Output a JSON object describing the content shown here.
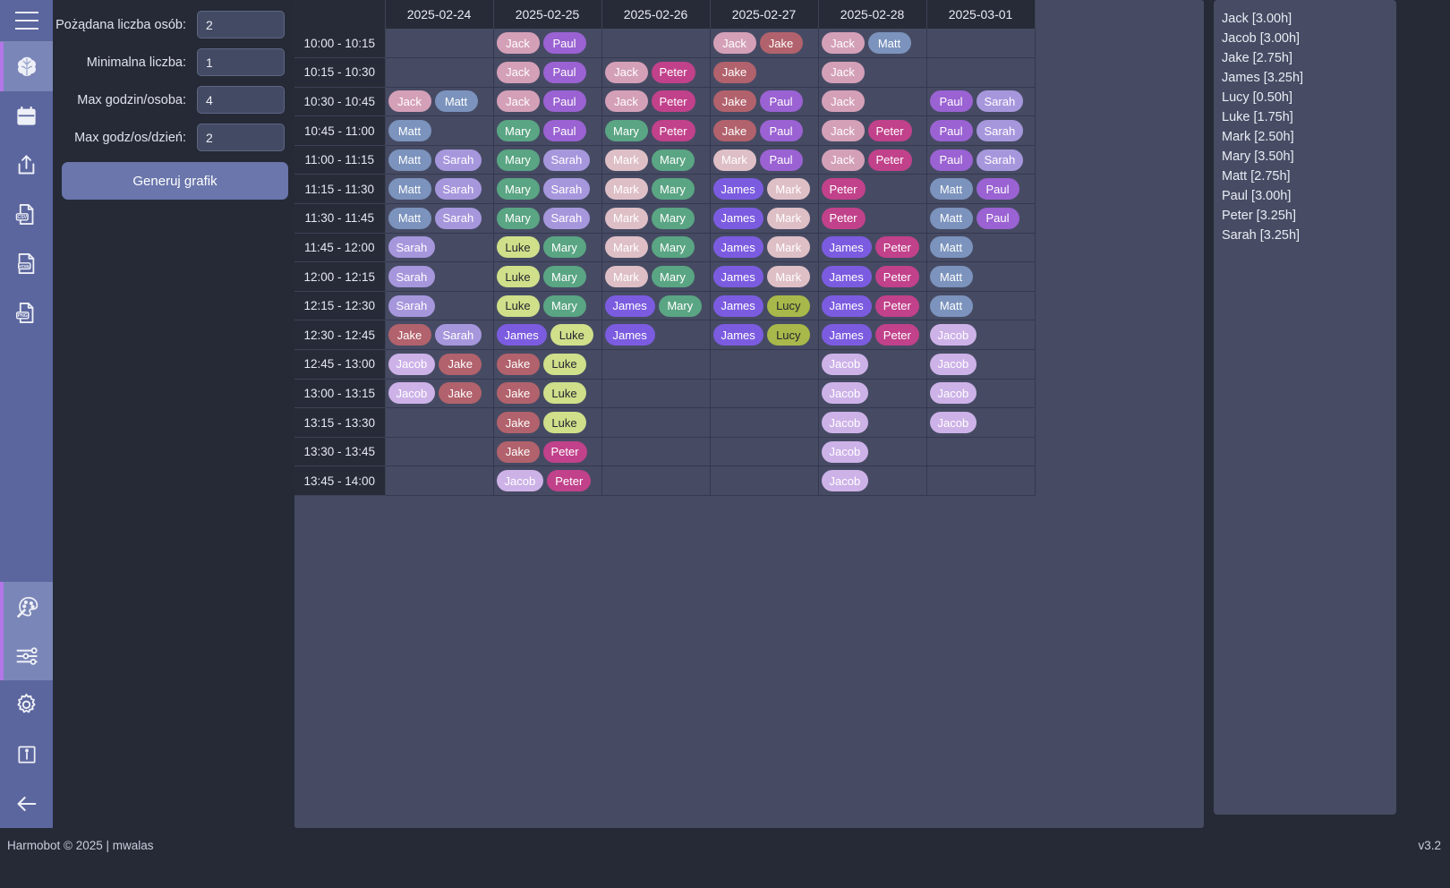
{
  "sidebar": {
    "menu_label": "menu",
    "items": [
      {
        "id": "brain",
        "icon": "brain-icon",
        "active": true
      },
      {
        "id": "calendar",
        "icon": "calendar-icon",
        "active": false
      },
      {
        "id": "export",
        "icon": "share-export-icon",
        "active": false
      },
      {
        "id": "csv",
        "icon": "csv-file-icon",
        "active": false
      },
      {
        "id": "html",
        "icon": "html-file-icon",
        "active": false
      },
      {
        "id": "png",
        "icon": "png-file-icon",
        "active": false
      }
    ],
    "bottom_items": [
      {
        "id": "palette",
        "icon": "palette-icon",
        "active": true
      },
      {
        "id": "sliders",
        "icon": "sliders-icon",
        "active": true
      },
      {
        "id": "settings",
        "icon": "gear-icon",
        "active": false
      },
      {
        "id": "info",
        "icon": "info-icon",
        "active": false
      },
      {
        "id": "back",
        "icon": "arrow-left-icon",
        "active": false
      }
    ]
  },
  "controls": {
    "fields": [
      {
        "label": "Pożądana liczba osób:",
        "value": "2",
        "name": "desired-people-count"
      },
      {
        "label": "Minimalna liczba:",
        "value": "1",
        "name": "minimum-count"
      },
      {
        "label": "Max godzin/osoba:",
        "value": "4",
        "name": "max-hours-per-person"
      },
      {
        "label": "Max godz/os/dzień:",
        "value": "2",
        "name": "max-hours-per-person-per-day"
      }
    ],
    "generate_label": "Generuj grafik"
  },
  "schedule": {
    "corner_label": "",
    "dates": [
      "2025-02-24",
      "2025-02-25",
      "2025-02-26",
      "2025-02-27",
      "2025-02-28",
      "2025-03-01"
    ],
    "person_colors": {
      "Jack": "#d4a0b8",
      "Jacob": "#cdb2e8",
      "Jake": "#b2626c",
      "James": "#7b5ce0",
      "Lucy": "#a8b councils",
      "Luke": "#cfdf8a",
      "Mark": "#debfc6",
      "Mary": "#5aa583",
      "Matt": "#7b93bd",
      "Paul": "#9a62d2",
      "Peter": "#c1418a",
      "Sarah": "#a697dd"
    },
    "rows": [
      {
        "time": "10:00 - 10:15",
        "cells": [
          [],
          [
            "Jack",
            "Paul"
          ],
          [],
          [
            "Jack",
            "Jake"
          ],
          [
            "Jack",
            "Matt"
          ],
          []
        ]
      },
      {
        "time": "10:15 - 10:30",
        "cells": [
          [],
          [
            "Jack",
            "Paul"
          ],
          [
            "Jack",
            "Peter"
          ],
          [
            "Jake"
          ],
          [
            "Jack"
          ],
          []
        ]
      },
      {
        "time": "10:30 - 10:45",
        "cells": [
          [
            "Jack",
            "Matt"
          ],
          [
            "Jack",
            "Paul"
          ],
          [
            "Jack",
            "Peter"
          ],
          [
            "Jake",
            "Paul"
          ],
          [
            "Jack"
          ],
          [
            "Paul",
            "Sarah"
          ]
        ]
      },
      {
        "time": "10:45 - 11:00",
        "cells": [
          [
            "Matt"
          ],
          [
            "Mary",
            "Paul"
          ],
          [
            "Mary",
            "Peter"
          ],
          [
            "Jake",
            "Paul"
          ],
          [
            "Jack",
            "Peter"
          ],
          [
            "Paul",
            "Sarah"
          ]
        ]
      },
      {
        "time": "11:00 - 11:15",
        "cells": [
          [
            "Matt",
            "Sarah"
          ],
          [
            "Mary",
            "Sarah"
          ],
          [
            "Mark",
            "Mary"
          ],
          [
            "Mark",
            "Paul"
          ],
          [
            "Jack",
            "Peter"
          ],
          [
            "Paul",
            "Sarah"
          ]
        ]
      },
      {
        "time": "11:15 - 11:30",
        "cells": [
          [
            "Matt",
            "Sarah"
          ],
          [
            "Mary",
            "Sarah"
          ],
          [
            "Mark",
            "Mary"
          ],
          [
            "James",
            "Mark"
          ],
          [
            "Peter"
          ],
          [
            "Matt",
            "Paul"
          ]
        ]
      },
      {
        "time": "11:30 - 11:45",
        "cells": [
          [
            "Matt",
            "Sarah"
          ],
          [
            "Mary",
            "Sarah"
          ],
          [
            "Mark",
            "Mary"
          ],
          [
            "James",
            "Mark"
          ],
          [
            "Peter"
          ],
          [
            "Matt",
            "Paul"
          ]
        ]
      },
      {
        "time": "11:45 - 12:00",
        "cells": [
          [
            "Sarah"
          ],
          [
            "Luke",
            "Mary"
          ],
          [
            "Mark",
            "Mary"
          ],
          [
            "James",
            "Mark"
          ],
          [
            "James",
            "Peter"
          ],
          [
            "Matt"
          ]
        ]
      },
      {
        "time": "12:00 - 12:15",
        "cells": [
          [
            "Sarah"
          ],
          [
            "Luke",
            "Mary"
          ],
          [
            "Mark",
            "Mary"
          ],
          [
            "James",
            "Mark"
          ],
          [
            "James",
            "Peter"
          ],
          [
            "Matt"
          ]
        ]
      },
      {
        "time": "12:15 - 12:30",
        "cells": [
          [
            "Sarah"
          ],
          [
            "Luke",
            "Mary"
          ],
          [
            "James",
            "Mary"
          ],
          [
            "James",
            "Lucy"
          ],
          [
            "James",
            "Peter"
          ],
          [
            "Matt"
          ]
        ]
      },
      {
        "time": "12:30 - 12:45",
        "cells": [
          [
            "Jake",
            "Sarah"
          ],
          [
            "James",
            "Luke"
          ],
          [
            "James"
          ],
          [
            "James",
            "Lucy"
          ],
          [
            "James",
            "Peter"
          ],
          [
            "Jacob"
          ]
        ]
      },
      {
        "time": "12:45 - 13:00",
        "cells": [
          [
            "Jacob",
            "Jake"
          ],
          [
            "Jake",
            "Luke"
          ],
          [],
          [],
          [
            "Jacob"
          ],
          [
            "Jacob"
          ]
        ]
      },
      {
        "time": "13:00 - 13:15",
        "cells": [
          [
            "Jacob",
            "Jake"
          ],
          [
            "Jake",
            "Luke"
          ],
          [],
          [],
          [
            "Jacob"
          ],
          [
            "Jacob"
          ]
        ]
      },
      {
        "time": "13:15 - 13:30",
        "cells": [
          [],
          [
            "Jake",
            "Luke"
          ],
          [],
          [],
          [
            "Jacob"
          ],
          [
            "Jacob"
          ]
        ]
      },
      {
        "time": "13:30 - 13:45",
        "cells": [
          [],
          [
            "Jake",
            "Peter"
          ],
          [],
          [],
          [
            "Jacob"
          ],
          []
        ]
      },
      {
        "time": "13:45 - 14:00",
        "cells": [
          [],
          [
            "Jacob",
            "Peter"
          ],
          [],
          [],
          [
            "Jacob"
          ],
          []
        ]
      }
    ]
  },
  "summary": {
    "entries": [
      "Jack [3.00h]",
      "Jacob [3.00h]",
      "Jake [2.75h]",
      "James [3.25h]",
      "Lucy [0.50h]",
      "Luke [1.75h]",
      "Mark [2.50h]",
      "Mary [3.50h]",
      "Matt [2.75h]",
      "Paul [3.00h]",
      "Peter [3.25h]",
      "Sarah [3.25h]"
    ]
  },
  "footer": {
    "left": "Harmobot © 2025 | mwalas",
    "right": "v3.2"
  }
}
